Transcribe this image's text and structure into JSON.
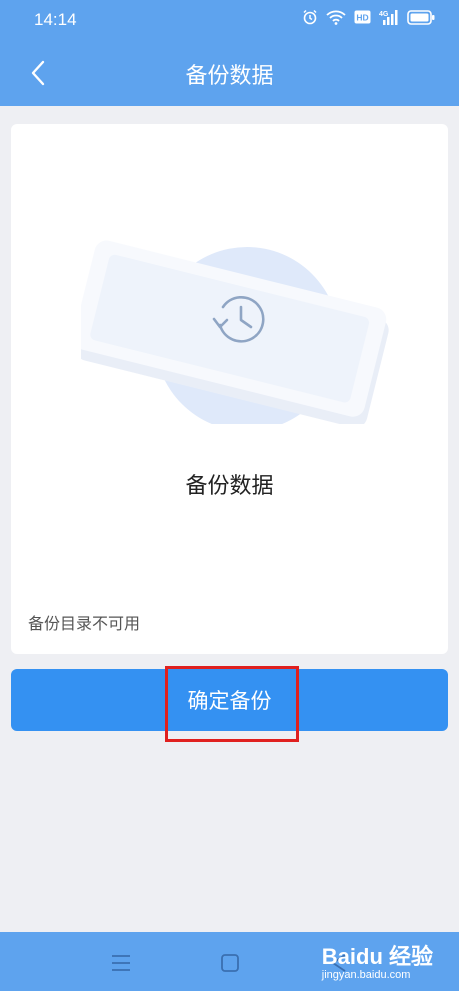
{
  "status_bar": {
    "time": "14:14",
    "icons": [
      "alarm-icon",
      "wifi-icon",
      "hd-badge",
      "4g-signal-icon",
      "battery-icon"
    ],
    "hd_label": "HD",
    "network_label": "4G"
  },
  "header": {
    "title": "备份数据",
    "back_icon": "chevron-left-icon"
  },
  "card": {
    "illustration": "phone-with-clock-icon",
    "heading": "备份数据",
    "note": "备份目录不可用"
  },
  "actions": {
    "confirm_label": "确定备份"
  },
  "nav_bar": {
    "items": [
      "menu-icon",
      "home-square-icon",
      "back-triangle-icon"
    ]
  },
  "watermark": {
    "brand": "Baidu 经验",
    "url": "jingyan.baidu.com"
  },
  "colors": {
    "header_blue": "#5ea3ee",
    "button_blue": "#3491f2",
    "highlight_red": "#e0201f",
    "page_bg": "#eeeff3"
  }
}
